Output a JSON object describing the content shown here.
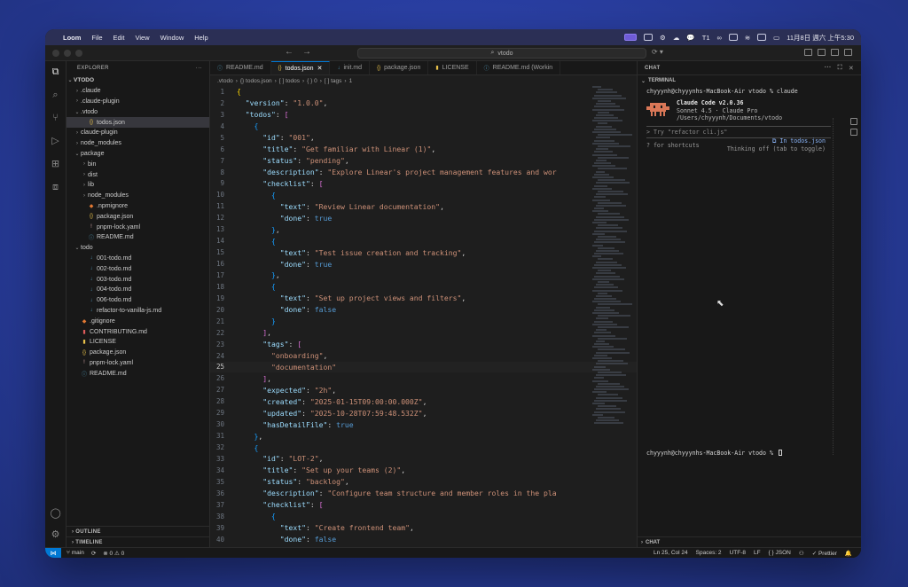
{
  "menubar": {
    "app": "Loom",
    "items": [
      "File",
      "Edit",
      "View",
      "Window",
      "Help"
    ],
    "clock": "11月8日 週六 上午5:30",
    "status_text": "T1"
  },
  "titlebar": {
    "search": "vtodo"
  },
  "explorer": {
    "title": "EXPLORER",
    "root": "VTODO",
    "items": [
      {
        "label": ".claude",
        "depth": 1,
        "kind": "folder",
        "open": false
      },
      {
        "label": ".claude-plugin",
        "depth": 1,
        "kind": "folder",
        "open": false
      },
      {
        "label": ".vtodo",
        "depth": 1,
        "kind": "folder",
        "open": true
      },
      {
        "label": "todos.json",
        "depth": 2,
        "kind": "json",
        "selected": true
      },
      {
        "label": "claude-plugin",
        "depth": 1,
        "kind": "folder",
        "open": false
      },
      {
        "label": "node_modules",
        "depth": 1,
        "kind": "folder",
        "open": false
      },
      {
        "label": "package",
        "depth": 1,
        "kind": "folder",
        "open": true
      },
      {
        "label": "bin",
        "depth": 2,
        "kind": "folder",
        "open": false
      },
      {
        "label": "dist",
        "depth": 2,
        "kind": "folder",
        "open": false
      },
      {
        "label": "lib",
        "depth": 2,
        "kind": "folder",
        "open": false
      },
      {
        "label": "node_modules",
        "depth": 2,
        "kind": "folder",
        "open": false
      },
      {
        "label": ".npmignore",
        "depth": 2,
        "kind": "ignore"
      },
      {
        "label": "package.json",
        "depth": 2,
        "kind": "json"
      },
      {
        "label": "pnpm-lock.yaml",
        "depth": 2,
        "kind": "yaml"
      },
      {
        "label": "README.md",
        "depth": 2,
        "kind": "info"
      },
      {
        "label": "todo",
        "depth": 1,
        "kind": "folder",
        "open": true
      },
      {
        "label": "001-todo.md",
        "depth": 2,
        "kind": "md"
      },
      {
        "label": "002-todo.md",
        "depth": 2,
        "kind": "md"
      },
      {
        "label": "003-todo.md",
        "depth": 2,
        "kind": "md"
      },
      {
        "label": "004-todo.md",
        "depth": 2,
        "kind": "md"
      },
      {
        "label": "006-todo.md",
        "depth": 2,
        "kind": "md"
      },
      {
        "label": "refactor-to-vanilla-js.md",
        "depth": 2,
        "kind": "md"
      },
      {
        "label": ".gitignore",
        "depth": 1,
        "kind": "ignore"
      },
      {
        "label": "CONTRIBUTING.md",
        "depth": 1,
        "kind": "contrib"
      },
      {
        "label": "LICENSE",
        "depth": 1,
        "kind": "license"
      },
      {
        "label": "package.json",
        "depth": 1,
        "kind": "json"
      },
      {
        "label": "pnpm-lock.yaml",
        "depth": 1,
        "kind": "yaml"
      },
      {
        "label": "README.md",
        "depth": 1,
        "kind": "info"
      }
    ],
    "outline": "OUTLINE",
    "timeline": "TIMELINE"
  },
  "tabs": [
    {
      "label": "README.md",
      "icon": "info",
      "active": false
    },
    {
      "label": "todos.json",
      "icon": "json",
      "active": true
    },
    {
      "label": "init.md",
      "icon": "md",
      "active": false
    },
    {
      "label": "package.json",
      "icon": "json",
      "active": false
    },
    {
      "label": "LICENSE",
      "icon": "license",
      "active": false
    },
    {
      "label": "README.md (Workin",
      "icon": "info",
      "active": false
    }
  ],
  "breadcrumb": [
    ".vtodo",
    "{} todos.json",
    "[ ] todos",
    "{ } 0",
    "[ ] tags",
    "1"
  ],
  "code": {
    "start_line": 1,
    "current_line": 25,
    "lines": [
      "{",
      "  \"version\": \"1.0.0\",",
      "  \"todos\": [",
      "    {",
      "      \"id\": \"001\",",
      "      \"title\": \"Get familiar with Linear (1)\",",
      "      \"status\": \"pending\",",
      "      \"description\": \"Explore Linear's project management features and wor",
      "      \"checklist\": [",
      "        {",
      "          \"text\": \"Review Linear documentation\",",
      "          \"done\": true",
      "        },",
      "        {",
      "          \"text\": \"Test issue creation and tracking\",",
      "          \"done\": true",
      "        },",
      "        {",
      "          \"text\": \"Set up project views and filters\",",
      "          \"done\": false",
      "        }",
      "      ],",
      "      \"tags\": [",
      "        \"onboarding\",",
      "        \"documentation\"",
      "      ],",
      "      \"expected\": \"2h\",",
      "      \"created\": \"2025-01-15T09:00:00.000Z\",",
      "      \"updated\": \"2025-10-28T07:59:48.532Z\",",
      "      \"hasDetailFile\": true",
      "    },",
      "    {",
      "      \"id\": \"LOT-2\",",
      "      \"title\": \"Set up your teams (2)\",",
      "      \"status\": \"backlog\",",
      "      \"description\": \"Configure team structure and member roles in the pla",
      "      \"checklist\": [",
      "        {",
      "          \"text\": \"Create frontend team\",",
      "          \"done\": false"
    ]
  },
  "chat": {
    "title": "CHAT",
    "terminal_label": "TERMINAL",
    "prompt_cmd": "chyyynh@chyyynhs-MacBook-Air vtodo % claude",
    "cc_title": "Claude Code v2.0.36",
    "cc_model": "Sonnet 4.5 · Claude Pro",
    "cc_path": "/Users/chyyynh/Documents/vtodo",
    "input_placeholder": "> Try \"refactor cli.js\"",
    "hint_left": "? for shortcuts",
    "hint_right_1": "⧉ In todos.json",
    "hint_right_2": "Thinking off (tab to toggle)",
    "prompt2": "chyyynh@chyyynhs-MacBook-Air vtodo % ",
    "footer": "CHAT"
  },
  "statusbar": {
    "branch": "main",
    "problems": "0",
    "warnings": "0",
    "position": "Ln 25, Col 24",
    "spaces": "Spaces: 2",
    "encoding": "UTF-8",
    "eol": "LF",
    "language": "{ } JSON",
    "formatter": "✓ Prettier"
  },
  "colors": {
    "accent": "#0078d4",
    "key": "#9cdcfe",
    "string": "#ce9178",
    "boolean": "#569cd6",
    "claude_logo": "#d97757"
  }
}
